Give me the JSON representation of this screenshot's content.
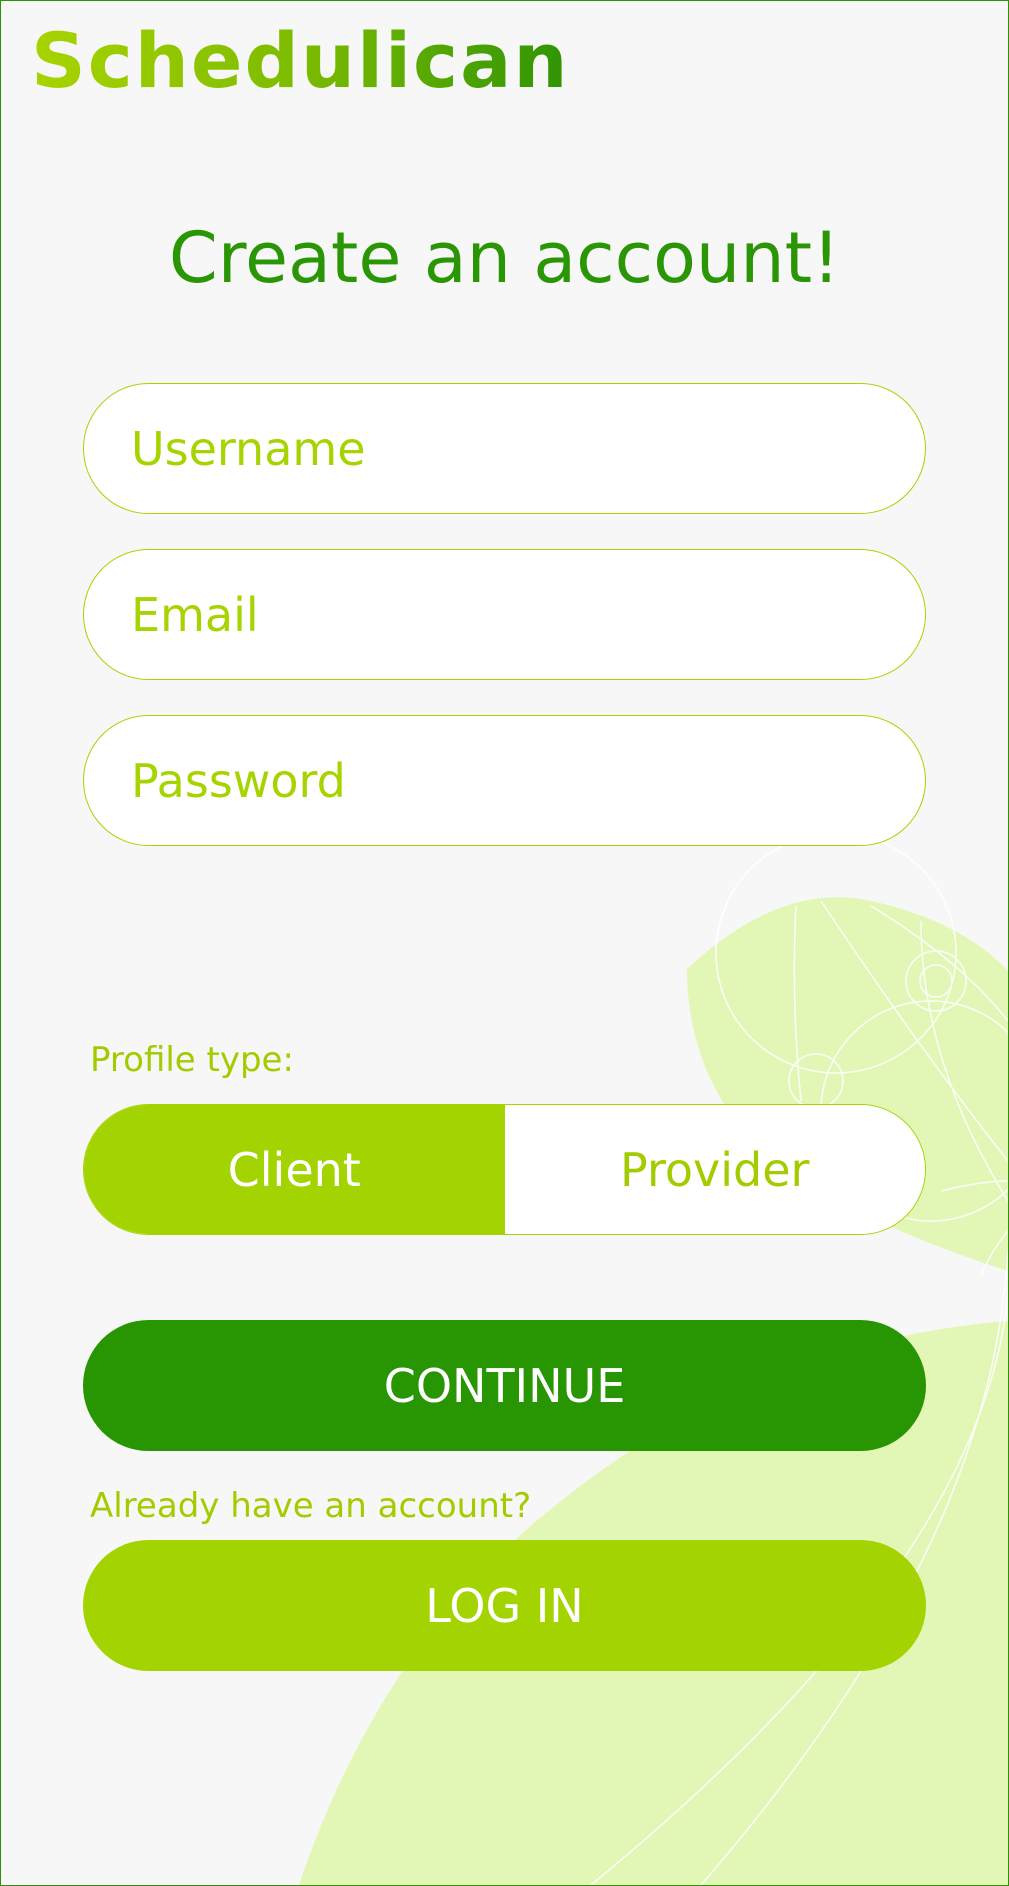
{
  "app": {
    "logo_text": "Schedulican"
  },
  "page": {
    "title": "Create an account!"
  },
  "form": {
    "username_placeholder": "Username",
    "email_placeholder": "Email",
    "password_placeholder": "Password",
    "username_value": "",
    "email_value": "",
    "password_value": ""
  },
  "profile": {
    "label": "Profile type:",
    "options": [
      "Client",
      "Provider"
    ],
    "selected": "Client"
  },
  "actions": {
    "continue_label": "CONTINUE",
    "login_prompt": "Already have an account?",
    "login_label": "LOG IN"
  },
  "colors": {
    "dark_green": "#289502",
    "lime": "#a3d300",
    "light_lime": "#e2f6b6",
    "background": "#f7f7f7"
  }
}
